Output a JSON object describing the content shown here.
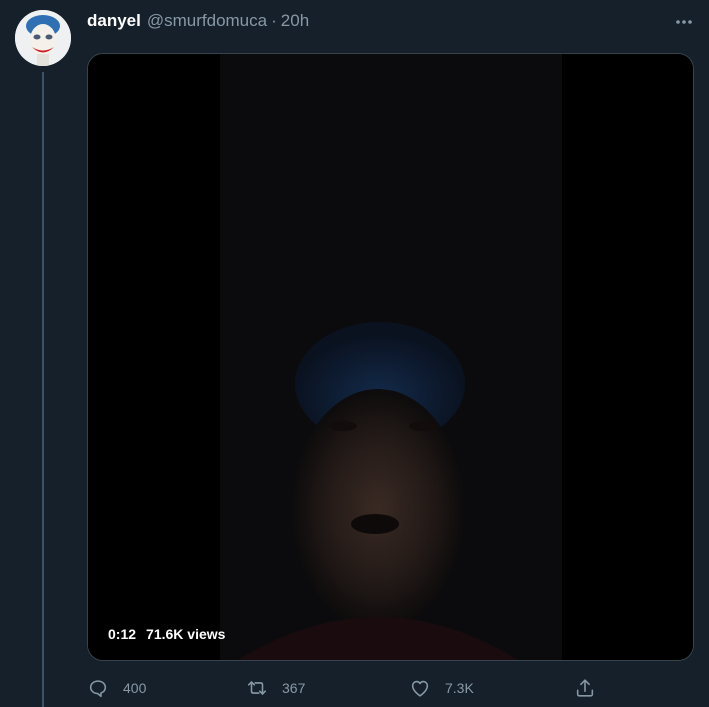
{
  "tweet": {
    "display_name": "danyel",
    "handle": "@smurfdomuca",
    "separator": "·",
    "time": "20h"
  },
  "media": {
    "duration": "0:12",
    "views": "71.6K views"
  },
  "actions": {
    "reply_count": "400",
    "retweet_count": "367",
    "like_count": "7.3K"
  },
  "icons": {
    "reply": "speech-bubble-icon",
    "retweet": "retweet-arrows-icon",
    "like": "heart-icon",
    "share": "share-upload-icon",
    "more": "ellipsis-icon"
  },
  "colors": {
    "background": "#15202b",
    "secondary_text": "#8899a6",
    "thread_line": "#3d5466",
    "card_border": "#38444d"
  }
}
